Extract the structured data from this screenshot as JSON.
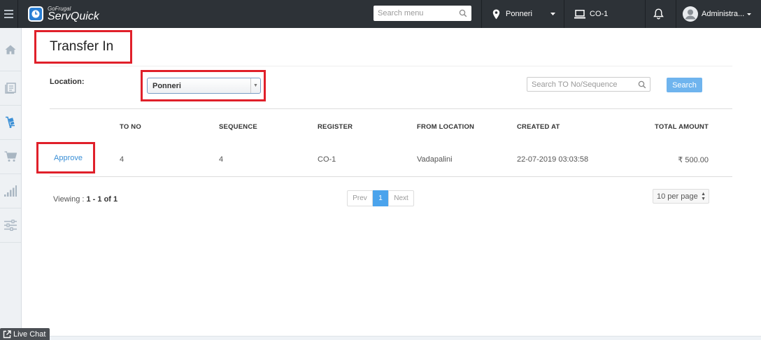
{
  "brand": {
    "small": "GoFrugal",
    "main": "ServQuick"
  },
  "topbar": {
    "search_placeholder": "Search menu",
    "location": "Ponneri",
    "register": "CO-1",
    "user": "Administra..."
  },
  "page": {
    "title": "Transfer In"
  },
  "filter": {
    "location_label": "Location:",
    "location_value": "Ponneri",
    "search_placeholder": "Search TO No/Sequence",
    "search_button": "Search"
  },
  "table": {
    "headers": [
      "TO NO",
      "SEQUENCE",
      "REGISTER",
      "FROM LOCATION",
      "CREATED AT",
      "TOTAL AMOUNT"
    ],
    "rows": [
      {
        "action": "Approve",
        "cells": [
          "4",
          "4",
          "CO-1",
          "Vadapalini",
          "22-07-2019 03:03:58",
          "₹ 500.00"
        ]
      }
    ]
  },
  "pagination": {
    "viewing_label": "Viewing : ",
    "viewing_value": "1 - 1 of 1",
    "prev": "Prev",
    "current": "1",
    "next": "Next",
    "per_page": "10 per page"
  },
  "livechat": {
    "label": "Live Chat"
  },
  "colors": {
    "topbar": "#2d3237",
    "accent": "#4aa3ec",
    "highlight": "#e0202a"
  }
}
